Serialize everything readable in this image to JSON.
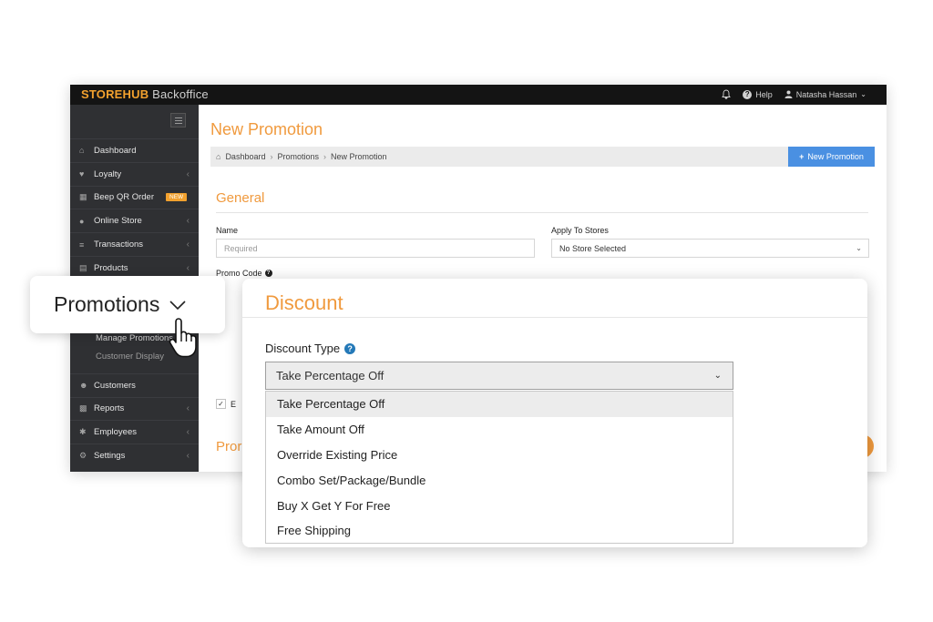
{
  "topbar": {
    "brand": "STOREHUB",
    "brand_suffix": "Backoffice",
    "help": "Help",
    "user": "Natasha Hassan"
  },
  "sidebar": {
    "items": [
      {
        "label": "Dashboard",
        "icon": "home-icon",
        "chevron": false
      },
      {
        "label": "Loyalty",
        "icon": "heart-icon",
        "chevron": true
      },
      {
        "label": "Beep QR Order",
        "icon": "qr-icon",
        "badge": "NEW",
        "chevron": false
      },
      {
        "label": "Online Store",
        "icon": "globe-icon",
        "chevron": true
      },
      {
        "label": "Transactions",
        "icon": "list-icon",
        "chevron": true
      },
      {
        "label": "Products",
        "icon": "cart-icon",
        "chevron": true
      },
      {
        "label": "Customers",
        "icon": "users-icon",
        "chevron": false
      },
      {
        "label": "Reports",
        "icon": "bar-chart-icon",
        "chevron": true
      },
      {
        "label": "Employees",
        "icon": "person-icon",
        "chevron": true
      },
      {
        "label": "Settings",
        "icon": "gears-icon",
        "chevron": true
      }
    ],
    "sub_items": [
      "Manage Promotions",
      "Customer Display"
    ]
  },
  "main": {
    "title": "New Promotion",
    "breadcrumb": [
      "Dashboard",
      "Promotions",
      "New Promotion"
    ],
    "new_button": "New Promotion",
    "section_general": "General",
    "name_label": "Name",
    "name_placeholder": "Required",
    "stores_label": "Apply To Stores",
    "stores_value": "No Store Selected",
    "promo_code_label": "Promo Code",
    "checkbox_label": "E",
    "section_pro": "Pror"
  },
  "callout": {
    "label": "Promotions"
  },
  "discount": {
    "title": "Discount",
    "type_label": "Discount Type",
    "selected": "Take Percentage Off",
    "options": [
      "Take Percentage Off",
      "Take Amount Off",
      "Override Existing Price",
      "Combo Set/Package/Bundle",
      "Buy X Get Y For Free",
      "Free Shipping"
    ],
    "highlighted_index": 0
  },
  "colors": {
    "accent": "#f09a3e",
    "primary_button": "#4a90e2",
    "sidebar": "#2f3033",
    "topbar": "#141414"
  }
}
